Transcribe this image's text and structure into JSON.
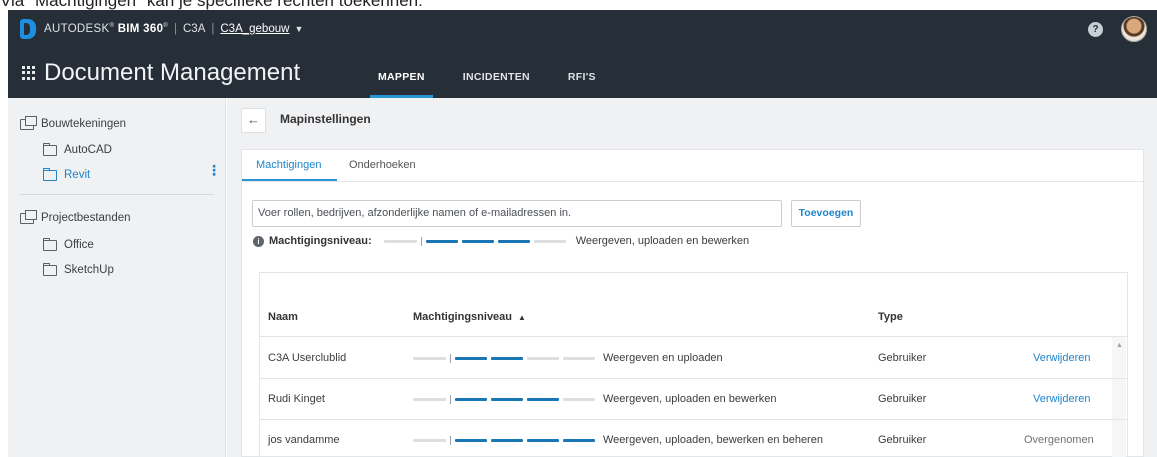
{
  "caption": "Via \"Machtigingen\" kan je specifieke rechten toekennen:",
  "topbar": {
    "brand_prefix": "AUTODESK",
    "brand_product": "BIM 360",
    "account": "C3A",
    "project": "C3A_gebouw",
    "app_title": "Document Management",
    "help": "?"
  },
  "nav": {
    "tabs": [
      {
        "label": "MAPPEN",
        "active": true
      },
      {
        "label": "INCIDENTEN",
        "active": false
      },
      {
        "label": "RFI'S",
        "active": false
      }
    ]
  },
  "sidebar": {
    "items": [
      {
        "label": "Bouwtekeningen",
        "type": "set"
      },
      {
        "label": "AutoCAD",
        "type": "folder"
      },
      {
        "label": "Revit",
        "type": "folder",
        "active": true
      },
      {
        "label": "Projectbestanden",
        "type": "set"
      },
      {
        "label": "Office",
        "type": "folder"
      },
      {
        "label": "SketchUp",
        "type": "folder"
      }
    ],
    "more_glyph": "⋮"
  },
  "main": {
    "back_glyph": "←",
    "title": "Mapinstellingen",
    "subtabs": [
      {
        "label": "Machtigingen",
        "active": true
      },
      {
        "label": "Onderhoeken",
        "active": false
      }
    ],
    "add_input_placeholder": "Voer rollen, bedrijven, afzonderlijke namen of e-mailadressen in.",
    "add_button": "Toevoegen",
    "level_label": "Machtigingsniveau:",
    "level_value": "Weergeven, uploaden en bewerken",
    "level_steps": 3,
    "info_glyph": "i"
  },
  "table": {
    "headers": {
      "name": "Naam",
      "level": "Machtigingsniveau",
      "type": "Type"
    },
    "sort_glyph": "▲",
    "rows": [
      {
        "name": "C3A Userclublid",
        "level_text": "Weergeven en uploaden",
        "level_steps": 2,
        "type": "Gebruiker",
        "action": "Verwijderen",
        "action_enabled": true
      },
      {
        "name": "Rudi Kinget",
        "level_text": "Weergeven, uploaden en bewerken",
        "level_steps": 3,
        "type": "Gebruiker",
        "action": "Verwijderen",
        "action_enabled": true
      },
      {
        "name": "jos vandamme",
        "level_text": "Weergeven, uploaden, bewerken en beheren",
        "level_steps": 4,
        "type": "Gebruiker",
        "action": "Overgenomen",
        "action_enabled": false
      }
    ]
  }
}
